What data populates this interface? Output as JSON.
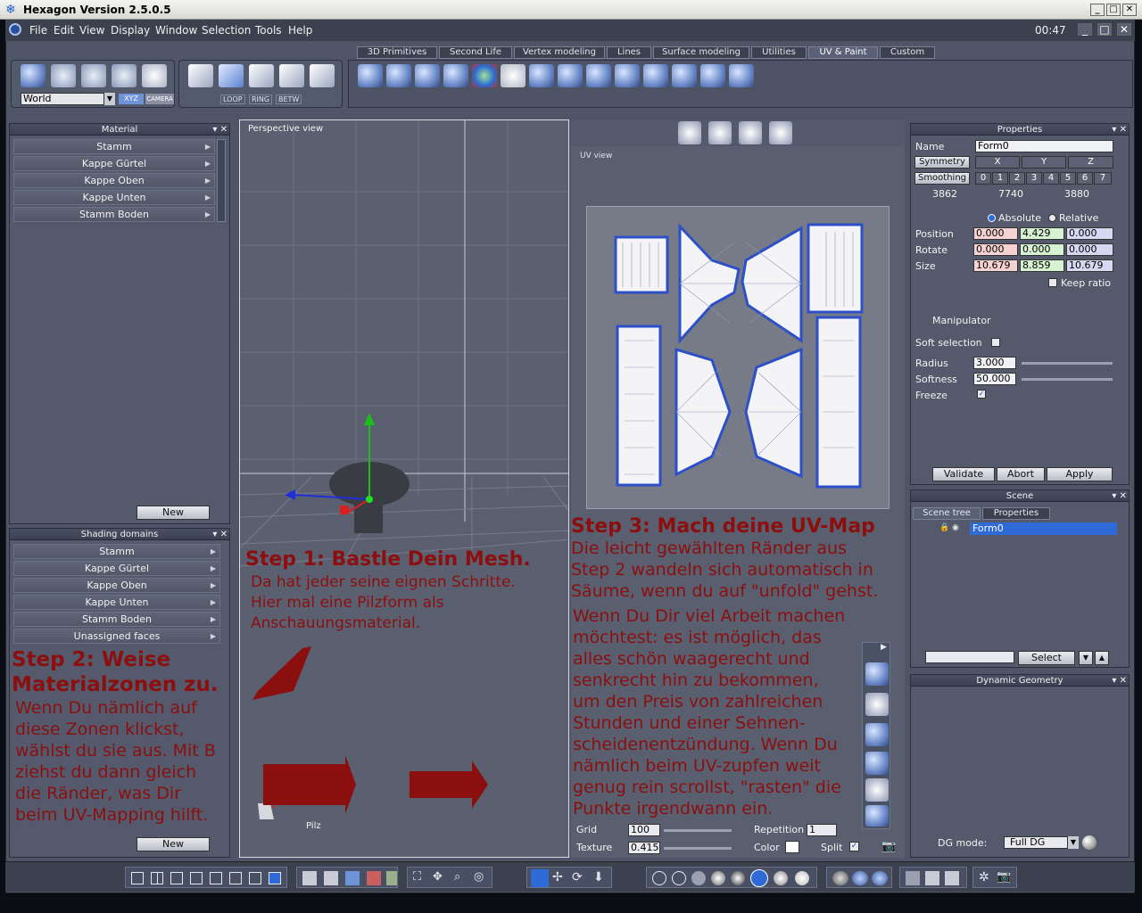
{
  "window": {
    "title": "Hexagon Version 2.5.0.5",
    "time": "00:47"
  },
  "menu": [
    "File",
    "Edit",
    "View",
    "Display",
    "Window",
    "Selection",
    "Tools",
    "Help"
  ],
  "tabs": [
    "3D Primitives",
    "Second Life",
    "Vertex modeling",
    "Lines",
    "Surface modeling",
    "Utilities",
    "UV & Paint",
    "Custom"
  ],
  "active_tab": "UV & Paint",
  "toolbar": {
    "world_select": "World",
    "xyz": "XYZ",
    "camera": "CAMERA",
    "loop": "LOOP",
    "ring": "RING",
    "betw": "BETW"
  },
  "material": {
    "title": "Material",
    "items": [
      "Stamm",
      "Kappe Gürtel",
      "Kappe Oben",
      "Kappe Unten",
      "Stamm Boden"
    ],
    "new_label": "New"
  },
  "shading": {
    "title": "Shading domains",
    "items": [
      "Stamm",
      "Kappe Gürtel",
      "Kappe Oben",
      "Kappe Unten",
      "Stamm Boden",
      "Unassigned faces"
    ],
    "new_label": "New"
  },
  "viewport": {
    "label": "Perspective view",
    "object_name": "Pilz"
  },
  "uvview": {
    "label": "UV view",
    "grid_label": "Grid",
    "grid_value": "100",
    "texture_label": "Texture",
    "texture_value": "0.415",
    "repetition_label": "Repetition",
    "repetition_value": "1",
    "color_label": "Color",
    "split_label": "Split"
  },
  "notes": {
    "step1_title": "Step 1: Bastle Dein Mesh.",
    "step1_text": [
      "Da hat jeder seine eignen Schritte.",
      "Hier mal eine Pilzform als",
      "Anschauungsmaterial."
    ],
    "step2_title_1": "Step 2: Weise",
    "step2_title_2": "Materialzonen zu.",
    "step2_text": [
      "Wenn Du nämlich auf",
      "diese Zonen klickst,",
      "wählst du sie aus. Mit B",
      "ziehst du dann gleich",
      "die Ränder, was Dir",
      "beim UV-Mapping hilft."
    ],
    "step3_title": "Step 3: Mach deine UV-Map",
    "step3_text": [
      "Die leicht gewählten Ränder aus",
      "Step 2 wandeln sich automatisch in",
      "Säume, wenn du auf \"unfold\" gehst."
    ],
    "step3_text2": [
      "Wenn Du Dir viel Arbeit machen",
      "möchtest: es ist möglich, das",
      "alles schön waagerecht und",
      "senkrecht hin zu bekommen,",
      "um den Preis von zahlreichen",
      "Stunden und einer Sehnen-",
      "scheidenentzündung. Wenn Du",
      "nämlich beim UV-zupfen weit",
      "genug rein scrollst, \"rasten\" die",
      "Punkte irgendwann ein."
    ]
  },
  "properties": {
    "title": "Properties",
    "name_label": "Name",
    "name_value": "Form0",
    "symmetry_label": "Symmetry",
    "axes": [
      "X",
      "Y",
      "Z"
    ],
    "smoothing_label": "Smoothing",
    "smoothing_levels": [
      "0",
      "1",
      "2",
      "3",
      "4",
      "5",
      "6",
      "7"
    ],
    "counts": [
      "3862",
      "7740",
      "3880"
    ],
    "absolute_label": "Absolute",
    "relative_label": "Relative",
    "position_label": "Position",
    "position": [
      "0.000",
      "4.429",
      "0.000"
    ],
    "rotate_label": "Rotate",
    "rotate": [
      "0.000",
      "0.000",
      "0.000"
    ],
    "size_label": "Size",
    "size": [
      "10.679",
      "8.859",
      "10.679"
    ],
    "keep_ratio_label": "Keep ratio",
    "manipulator_label": "Manipulator",
    "soft_selection_label": "Soft selection",
    "radius_label": "Radius",
    "radius_value": "3.000",
    "softness_label": "Softness",
    "softness_value": "50.000",
    "freeze_label": "Freeze",
    "validate": "Validate",
    "abort": "Abort",
    "apply": "Apply"
  },
  "scene": {
    "title": "Scene",
    "tab_tree": "Scene tree",
    "tab_props": "Properties",
    "item": "Form0",
    "select_label": "Select"
  },
  "dynamic": {
    "title": "Dynamic Geometry",
    "dg_mode_label": "DG mode:",
    "dg_mode_value": "Full DG"
  },
  "colors": {
    "accent": "#2f6bd6",
    "note_red": "#8c0f0f",
    "panel": "#54596b"
  }
}
